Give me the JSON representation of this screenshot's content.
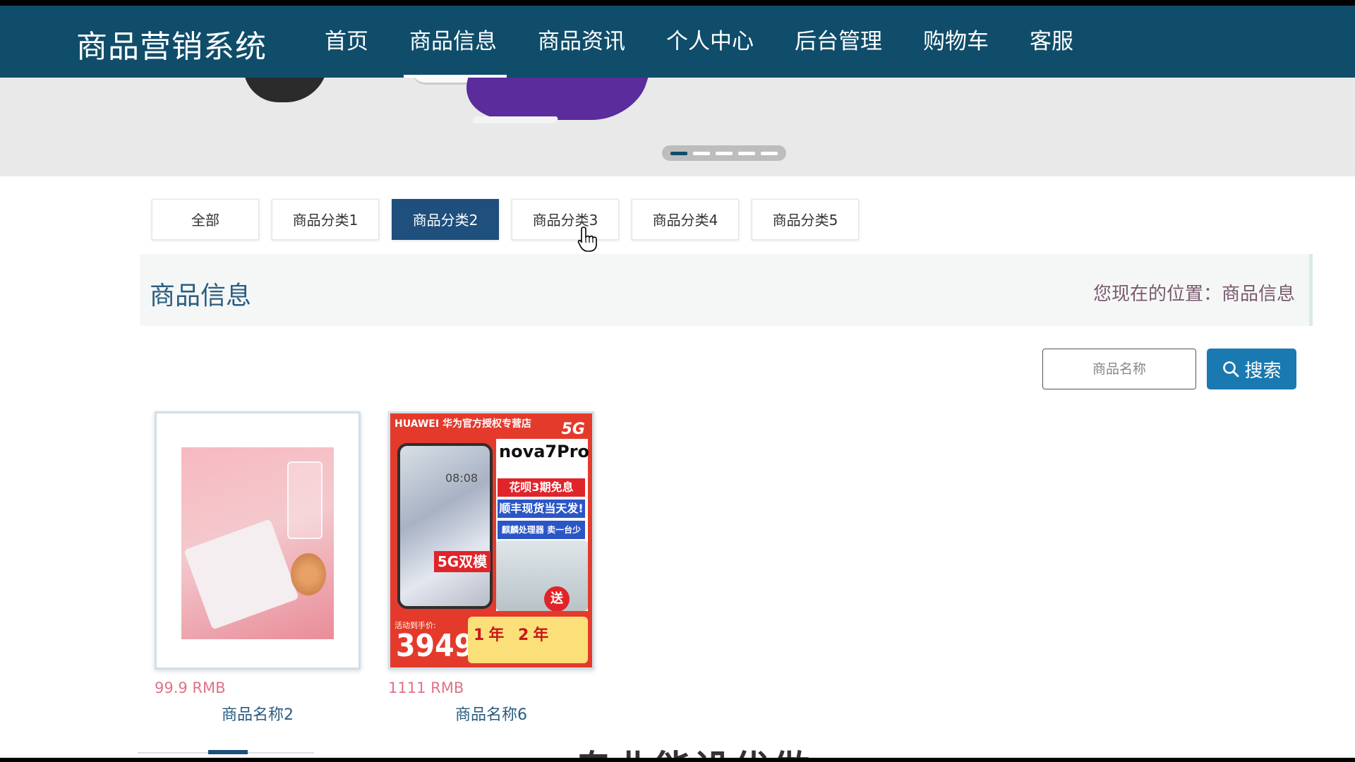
{
  "brand": "商品营销系统",
  "nav": {
    "items": [
      {
        "label": "首页"
      },
      {
        "label": "商品信息",
        "active": true
      },
      {
        "label": "商品资讯"
      },
      {
        "label": "个人中心"
      },
      {
        "label": "后台管理"
      },
      {
        "label": "购物车"
      },
      {
        "label": "客服"
      }
    ]
  },
  "banner": {
    "slide_count": 5,
    "active_slide": 1
  },
  "categories": [
    {
      "label": "全部"
    },
    {
      "label": "商品分类1"
    },
    {
      "label": "商品分类2",
      "active": true
    },
    {
      "label": "商品分类3"
    },
    {
      "label": "商品分类4"
    },
    {
      "label": "商品分类5"
    }
  ],
  "section": {
    "title": "商品信息",
    "breadcrumb": "您现在的位置：商品信息"
  },
  "search": {
    "placeholder": "商品名称",
    "button_label": "搜索"
  },
  "products": [
    {
      "price": "99.9 RMB",
      "name": "商品名称2"
    },
    {
      "price": "1111 RMB",
      "name": "商品名称6",
      "image_text": {
        "store": "HUAWEI 华为官方授权专营店",
        "network": "5G",
        "model": "nova7Pro",
        "phone_time": "08:08",
        "tag1": "花呗3期免息",
        "tag2": "顺丰现货当天发!",
        "tag3": "麒麟处理器 卖一台少一台",
        "badge": "5G双模",
        "gift": "送",
        "activity_label": "活动到手价:",
        "big_price": "3949",
        "warranty": "1年 2年"
      }
    }
  ],
  "footer": {
    "subtitle": "专业能设优做"
  },
  "colors": {
    "nav_bg": "#0f4d6a",
    "active_tab": "#1e4f7d",
    "search_button": "#1a79b0",
    "price": "#e07287"
  }
}
